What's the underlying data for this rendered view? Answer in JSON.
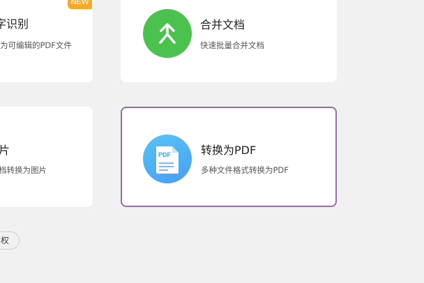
{
  "cards": {
    "ocr": {
      "title_partial": "字识别",
      "desc_partial": "为可编辑的PDF文件",
      "badge": "NEW"
    },
    "merge": {
      "title": "合并文档",
      "desc": "快速批量合并文档"
    },
    "to_image": {
      "title_partial": "片",
      "desc_partial": "档转换为图片"
    },
    "to_pdf": {
      "title": "转换为PDF",
      "desc": "多种文件格式转换为PDF",
      "icon_text": "PDF"
    }
  },
  "bottom": {
    "pill_partial": "权"
  },
  "colors": {
    "background": "#f2f1f2",
    "card": "#ffffff",
    "selected_border": "#9a6ca7",
    "merge_icon": "#4cc24e",
    "pdf_icon": "#4aa9f5",
    "badge": "#f6a926"
  },
  "icons": {
    "merge": "merge-arrows-icon",
    "to_pdf": "pdf-document-icon"
  }
}
